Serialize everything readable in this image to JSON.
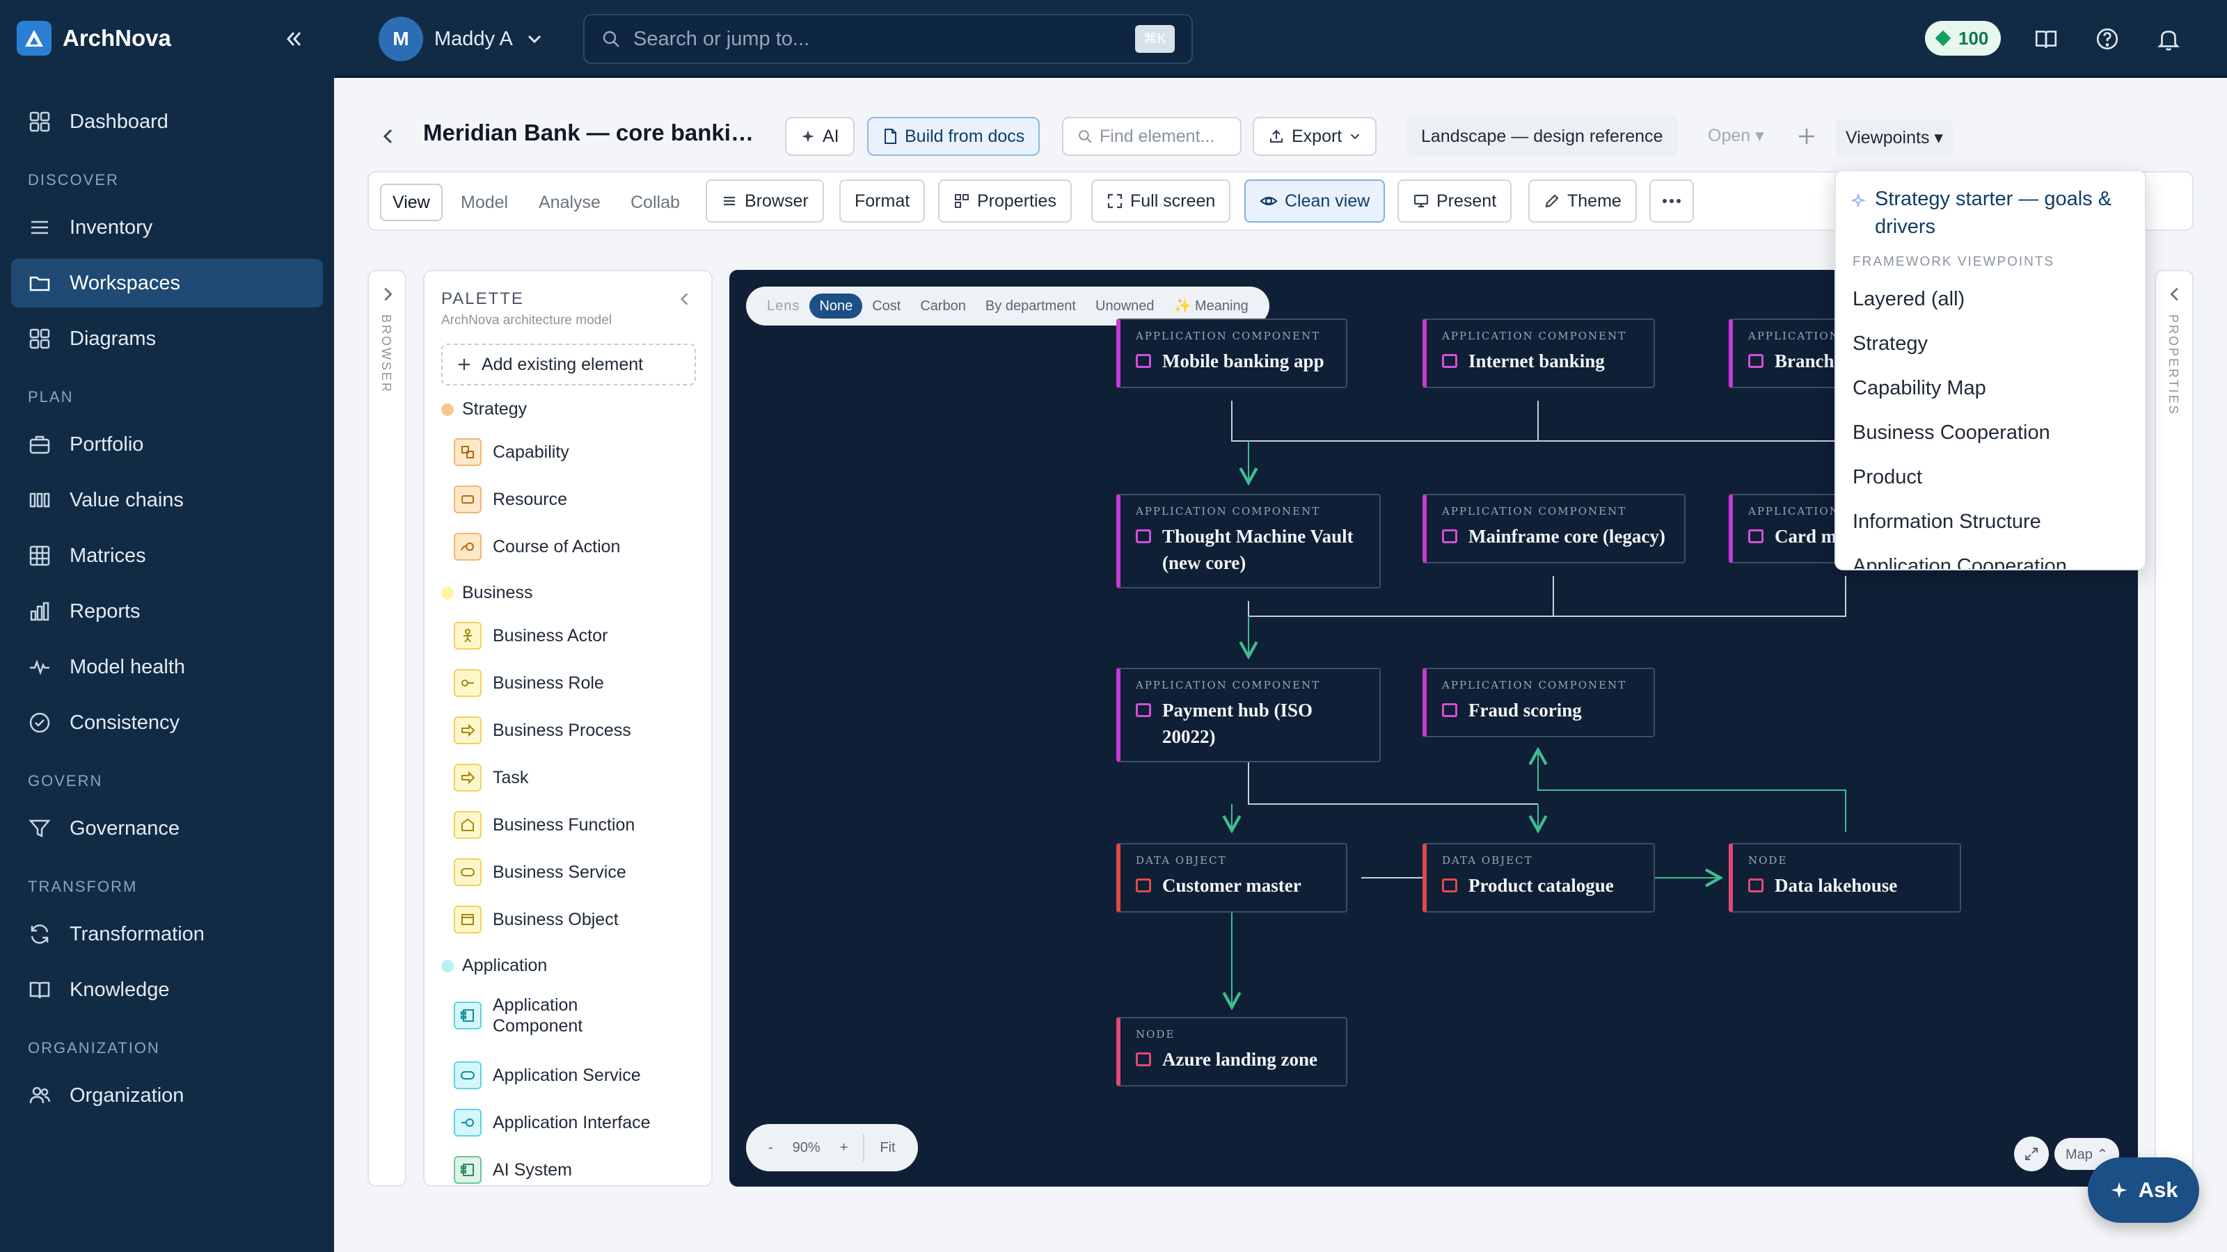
{
  "app": {
    "name": "ArchNova"
  },
  "sidebar": {
    "sections": [
      {
        "label": "",
        "items": [
          {
            "label": "Dashboard",
            "icon": "dashboard-icon"
          }
        ]
      },
      {
        "label": "DISCOVER",
        "items": [
          {
            "label": "Inventory",
            "icon": "list-icon"
          },
          {
            "label": "Workspaces",
            "icon": "folder-icon",
            "active": true
          },
          {
            "label": "Diagrams",
            "icon": "grid-icon"
          }
        ]
      },
      {
        "label": "PLAN",
        "items": [
          {
            "label": "Portfolio",
            "icon": "briefcase-icon"
          },
          {
            "label": "Value chains",
            "icon": "columns-icon"
          },
          {
            "label": "Matrices",
            "icon": "table-icon"
          },
          {
            "label": "Reports",
            "icon": "bar-chart-icon"
          },
          {
            "label": "Model health",
            "icon": "pulse-icon"
          },
          {
            "label": "Consistency",
            "icon": "check-circle-icon"
          }
        ]
      },
      {
        "label": "GOVERN",
        "items": [
          {
            "label": "Governance",
            "icon": "filter-icon"
          }
        ]
      },
      {
        "label": "TRANSFORM",
        "items": [
          {
            "label": "Transformation",
            "icon": "refresh-icon"
          },
          {
            "label": "Knowledge",
            "icon": "book-icon"
          }
        ]
      },
      {
        "label": "ORGANIZATION",
        "items": [
          {
            "label": "Organization",
            "icon": "users-icon"
          }
        ]
      }
    ]
  },
  "topbar": {
    "user_initial": "M",
    "user_name": "Maddy A",
    "search_placeholder": "Search or jump to...",
    "search_shortcut": "⌘K",
    "credits": "100"
  },
  "header": {
    "title": "Meridian Bank — core banking modernisation",
    "ai_label": "AI",
    "build_label": "Build from docs",
    "find_placeholder": "Find element...",
    "export_label": "Export",
    "landscape_label": "Landscape — design reference",
    "open_label": "Open ▾",
    "viewpoints_label": "Viewpoints ▾"
  },
  "toolbar": {
    "tabs": [
      "View",
      "Model",
      "Analyse",
      "Collab"
    ],
    "buttons": [
      "Browser",
      "Format",
      "Properties",
      "Full screen",
      "Clean view",
      "Present",
      "Theme"
    ]
  },
  "rails": {
    "left": "BROWSER",
    "right": "PROPERTIES"
  },
  "palette": {
    "title": "PALETTE",
    "subtitle": "ArchNova architecture model",
    "add_label": "Add existing element",
    "groups": [
      {
        "name": "Strategy",
        "color": "#f5c98a",
        "items": [
          "Capability",
          "Resource",
          "Course of Action"
        ]
      },
      {
        "name": "Business",
        "color": "#fff3a6",
        "items": [
          "Business Actor",
          "Business Role",
          "Business Process",
          "Task",
          "Business Function",
          "Business Service",
          "Business Object"
        ]
      },
      {
        "name": "Application",
        "color": "#b7f0f7",
        "items": [
          "Application Component",
          "Application Service",
          "Application Interface",
          "AI System"
        ]
      }
    ]
  },
  "canvas": {
    "lens": {
      "label": "Lens",
      "options": [
        "None",
        "Cost",
        "Carbon",
        "By department",
        "Unowned",
        "✨ Meaning"
      ],
      "selected": "None"
    },
    "zoom": {
      "minus": "-",
      "level": "90%",
      "plus": "+",
      "fit": "Fit"
    },
    "map_label": "Map ⌃",
    "nodes": [
      {
        "type": "APPLICATION COMPONENT",
        "name": "Mobile banking app",
        "kind": "app"
      },
      {
        "type": "APPLICATION COMPONENT",
        "name": "Internet banking",
        "kind": "app"
      },
      {
        "type": "APPLICATION COMPONENT",
        "name": "Branch",
        "kind": "app"
      },
      {
        "type": "APPLICATION COMPONENT",
        "name": "Thought Machine Vault (new core)",
        "kind": "app"
      },
      {
        "type": "APPLICATION COMPONENT",
        "name": "Mainframe core (legacy)",
        "kind": "app"
      },
      {
        "type": "APPLICATION COMPONENT",
        "name": "Card m",
        "kind": "app"
      },
      {
        "type": "APPLICATION COMPONENT",
        "name": "Payment hub (ISO 20022)",
        "kind": "app"
      },
      {
        "type": "APPLICATION COMPONENT",
        "name": "Fraud scoring",
        "kind": "app"
      },
      {
        "type": "DATA OBJECT",
        "name": "Customer master",
        "kind": "data"
      },
      {
        "type": "DATA OBJECT",
        "name": "Product catalogue",
        "kind": "data"
      },
      {
        "type": "NODE",
        "name": "Data lakehouse",
        "kind": "infra"
      },
      {
        "type": "NODE",
        "name": "Azure landing zone",
        "kind": "infra"
      }
    ]
  },
  "viewpoints_menu": {
    "featured": "Strategy starter — goals & drivers",
    "section_label": "FRAMEWORK VIEWPOINTS",
    "items": [
      "Layered (all)",
      "Strategy",
      "Capability Map",
      "Business Cooperation",
      "Product",
      "Information Structure",
      "Application Cooperation"
    ]
  },
  "ask_label": "Ask",
  "colors": {
    "sidebar": "#112b45",
    "accent": "#1c4f86",
    "canvas": "#0f1f36",
    "app_border": "#c73bd4",
    "data_border": "#e04848",
    "edge": "#3fbf8f"
  }
}
